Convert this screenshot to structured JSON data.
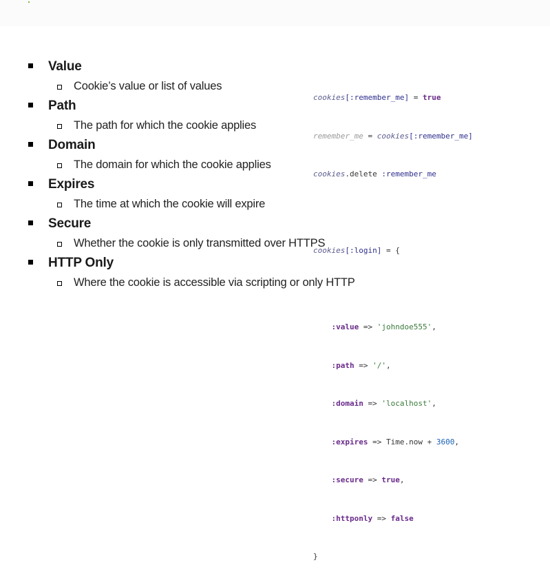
{
  "bullets": [
    {
      "heading": "Value",
      "detail": "Cookie’s value or list of values"
    },
    {
      "heading": "Path",
      "detail": "The path for which the cookie applies"
    },
    {
      "heading": "Domain",
      "detail": "The domain for which the cookie applies"
    },
    {
      "heading": "Expires",
      "detail": "The time at which the cookie will expire"
    },
    {
      "heading": "Secure",
      "detail": "Whether the cookie is only transmitted over HTTPS"
    },
    {
      "heading": "HTTP Only",
      "detail": "Where the cookie is accessible via scripting or only HTTP"
    }
  ],
  "code": {
    "l1": {
      "obj": "cookies",
      "key": "[:remember_me]",
      "eq": " = ",
      "val": "true"
    },
    "l2": {
      "var": "remember_me",
      "eq": " = ",
      "obj": "cookies",
      "key": "[:remember_me]"
    },
    "l3": {
      "obj": "cookies",
      "method": ".delete ",
      "arg": ":remember_me"
    },
    "l4": {
      "obj": "cookies",
      "key": "[:login]",
      "rest": " = {"
    },
    "entries": [
      {
        "key": ":value",
        "arrow": " => ",
        "val": "'johndoe555'",
        "tail": ","
      },
      {
        "key": ":path",
        "arrow": " => ",
        "val": "'/'",
        "tail": ","
      },
      {
        "key": ":domain",
        "arrow": " => ",
        "val": "'localhost'",
        "tail": ","
      },
      {
        "key": ":expires",
        "arrow": " => ",
        "val": "Time.now + ",
        "num": "3600",
        "tail": ","
      },
      {
        "key": ":secure",
        "arrow": " => ",
        "val": "true",
        "tail": ","
      },
      {
        "key": ":httponly",
        "arrow": " => ",
        "val": "false",
        "tail": ""
      }
    ],
    "close": "}"
  }
}
